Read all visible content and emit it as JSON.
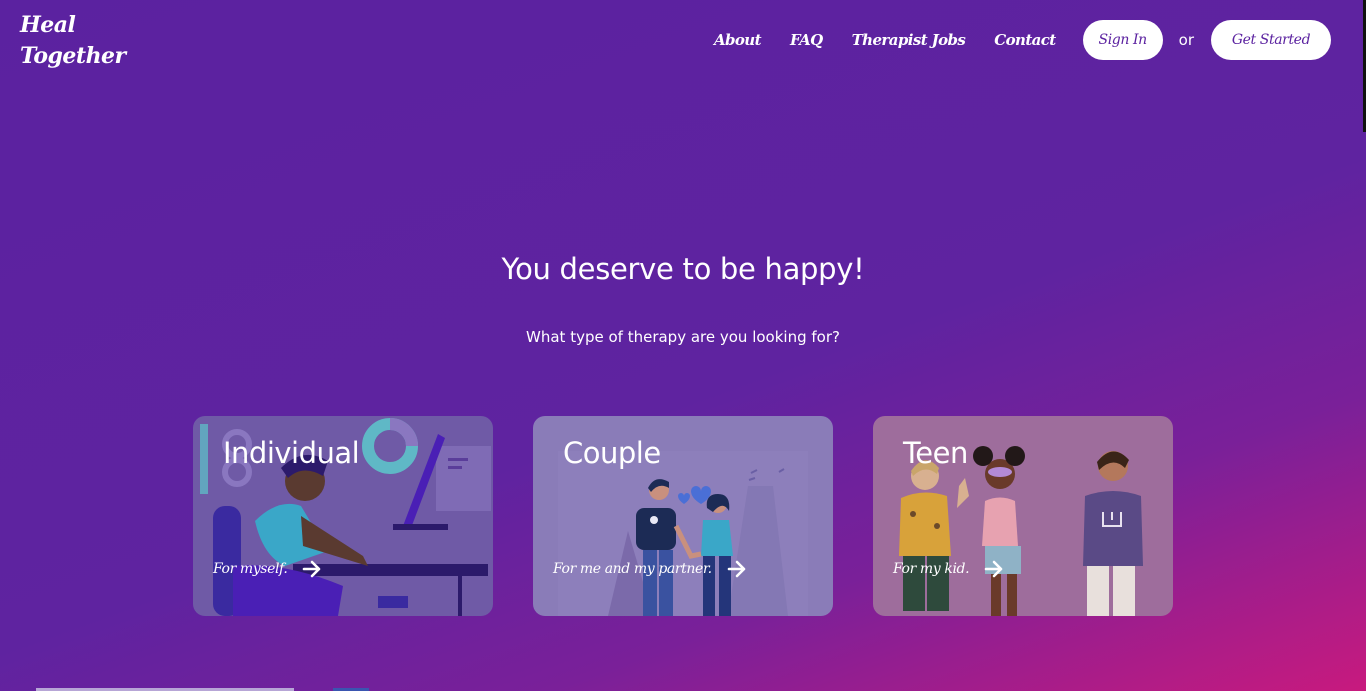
{
  "logo": {
    "line1": "Heal",
    "line2": "Together"
  },
  "nav": {
    "links": [
      "About",
      "FAQ",
      "Therapist Jobs",
      "Contact"
    ],
    "sign_in": "Sign In",
    "or": "or",
    "get_started": "Get Started"
  },
  "hero": {
    "title": "You deserve to be happy!",
    "subtitle": "What type of therapy are you looking for?"
  },
  "cards": [
    {
      "title": "Individual",
      "subtitle": "For myself.",
      "arrow_icon": "arrow-right-icon"
    },
    {
      "title": "Couple",
      "subtitle": "For me and my partner.",
      "arrow_icon": "arrow-right-icon"
    },
    {
      "title": "Teen",
      "subtitle": "For my kid.",
      "arrow_icon": "arrow-right-icon"
    }
  ],
  "colors": {
    "background": "#5b22a0",
    "accent_pink": "#c81a7e",
    "button_bg": "#ffffff",
    "button_text": "#5b22a0"
  }
}
